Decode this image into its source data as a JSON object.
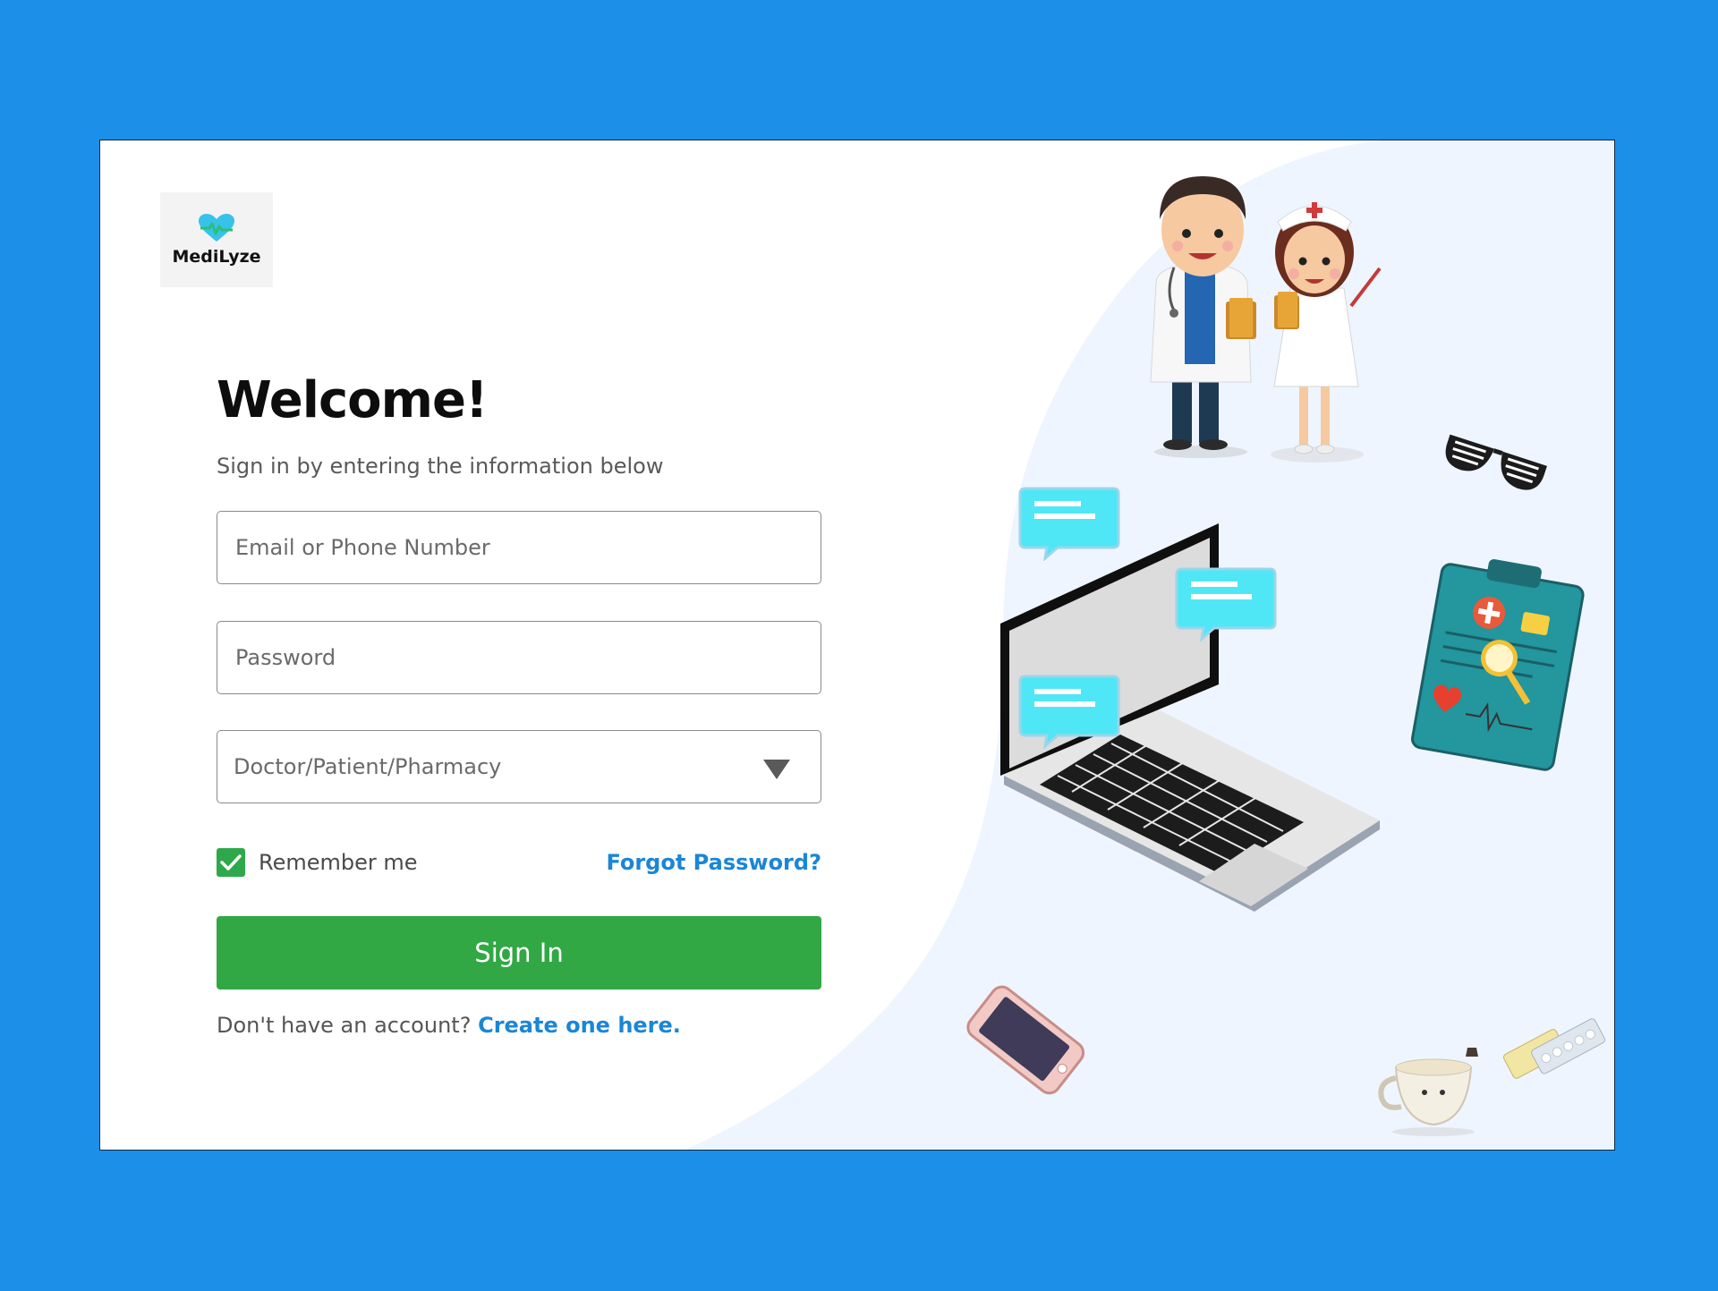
{
  "brand": {
    "name": "MediLyze",
    "icon": "heart-pulse-icon"
  },
  "login": {
    "title": "Welcome!",
    "subtitle": "Sign in by entering the information below",
    "email_placeholder": "Email or Phone Number",
    "password_placeholder": "Password",
    "role_select": "Doctor/Patient/Pharmacy",
    "remember_label": "Remember me",
    "remember_checked": true,
    "forgot_label": "Forgot Password?",
    "signin_label": "Sign In",
    "signup_prompt": "Don't have an account?",
    "signup_link": "Create one here."
  },
  "colors": {
    "background": "#1c8fe9",
    "primary_button": "#31a844",
    "link": "#1a86d8",
    "illustration_bg": "#eef5ff"
  },
  "illustration": {
    "elements": [
      "doctor",
      "nurse",
      "laptop",
      "chat-bubbles",
      "sunglasses",
      "clipboard",
      "smartphone",
      "coffee-cup",
      "pill-packs"
    ]
  }
}
